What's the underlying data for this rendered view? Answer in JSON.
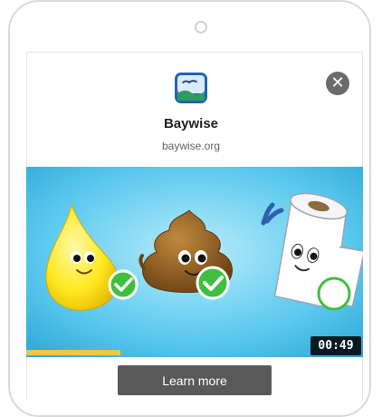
{
  "ad": {
    "app_name": "Baywise",
    "app_url": "baywise.org",
    "cta_label": "Learn more",
    "app_icon": "baywise-logo-icon",
    "close_icon": "close-icon"
  },
  "video": {
    "timestamp": "00:49",
    "progress": 0.28,
    "characters": [
      "pee-drop-mascot",
      "poop-mascot",
      "toilet-paper-mascot"
    ],
    "characters_checked": [
      true,
      true,
      false
    ]
  },
  "colors": {
    "cta_background": "#595959",
    "progress_bar": "#f4c542",
    "video_sky": "#4fc3e8",
    "check_green": "#3fbf3f"
  }
}
